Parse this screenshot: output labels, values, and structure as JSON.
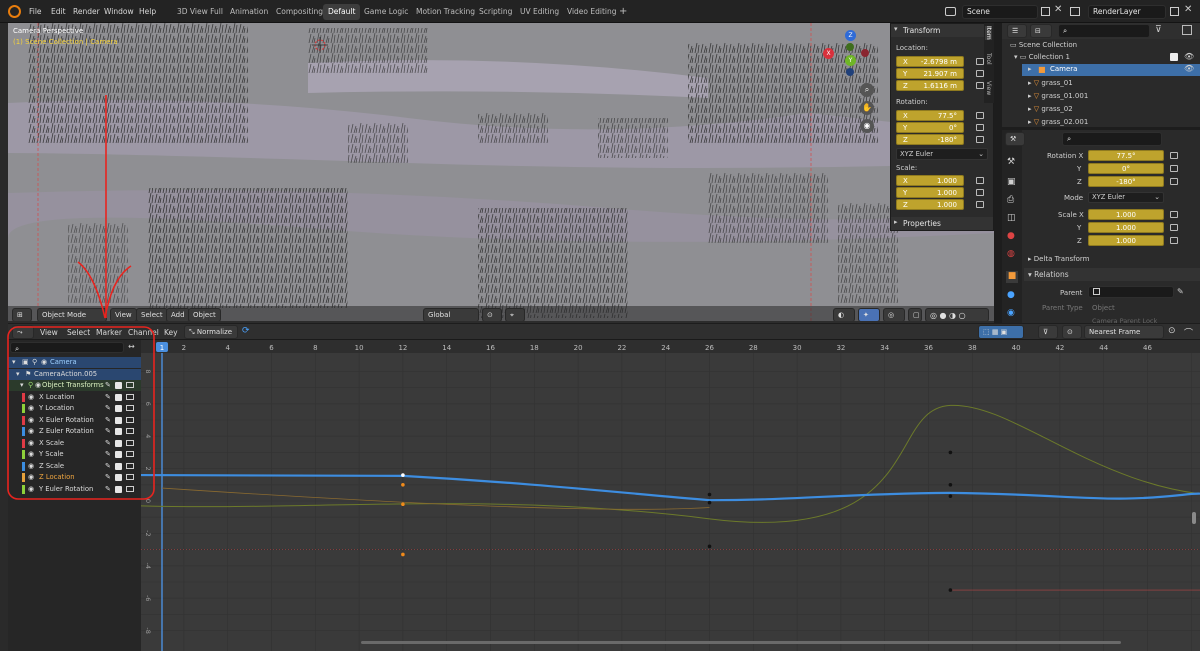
{
  "topbar": {
    "menus": [
      "File",
      "Edit",
      "Render",
      "Window",
      "Help"
    ],
    "workspaces": [
      "3D View Full",
      "Animation",
      "Compositing",
      "Default",
      "Game Logic",
      "Motion Tracking",
      "Scripting",
      "UV Editing",
      "Video Editing"
    ],
    "active_workspace": "Default",
    "add_tab": "+",
    "scene": "Scene",
    "render_layer": "RenderLayer"
  },
  "viewport": {
    "title": "Camera Perspective",
    "subtitle": "(1) Scene Collection | Camera",
    "mode": "Object Mode",
    "menus": [
      "View",
      "Select",
      "Add",
      "Object"
    ],
    "orientation": "Global",
    "gizmo": {
      "x": "X",
      "y": "Y",
      "z": "Z"
    }
  },
  "npanel": {
    "header": "Transform",
    "location_label": "Location:",
    "location": [
      {
        "axis": "X",
        "value": "-2.6798 m"
      },
      {
        "axis": "Y",
        "value": "21.907 m"
      },
      {
        "axis": "Z",
        "value": "1.6116 m"
      }
    ],
    "rotation_label": "Rotation:",
    "rotation": [
      {
        "axis": "X",
        "value": "77.5°"
      },
      {
        "axis": "Y",
        "value": "0°"
      },
      {
        "axis": "Z",
        "value": "-180°"
      }
    ],
    "rotation_mode": "XYZ Euler",
    "scale_label": "Scale:",
    "scale": [
      {
        "axis": "X",
        "value": "1.000"
      },
      {
        "axis": "Y",
        "value": "1.000"
      },
      {
        "axis": "Z",
        "value": "1.000"
      }
    ],
    "properties": "Properties",
    "tabs": [
      "Item",
      "Tool",
      "View"
    ]
  },
  "outliner": {
    "items": [
      {
        "name": "Scene Collection",
        "level": 0
      },
      {
        "name": "Collection 1",
        "level": 1
      },
      {
        "name": "Camera",
        "level": 2,
        "selected": true
      },
      {
        "name": "grass_01",
        "level": 2
      },
      {
        "name": "grass_01.001",
        "level": 2
      },
      {
        "name": "grass_02",
        "level": 2
      },
      {
        "name": "grass_02.001",
        "level": 2
      }
    ]
  },
  "properties": {
    "rotation": [
      {
        "label": "Rotation X",
        "value": "77.5°"
      },
      {
        "label": "Y",
        "value": "0°"
      },
      {
        "label": "Z",
        "value": "-180°"
      }
    ],
    "mode_label": "Mode",
    "mode_value": "XYZ Euler",
    "scale": [
      {
        "label": "Scale X",
        "value": "1.000"
      },
      {
        "label": "Y",
        "value": "1.000"
      },
      {
        "label": "Z",
        "value": "1.000"
      }
    ],
    "delta": "Delta Transform",
    "relations": "Relations",
    "parent_label": "Parent",
    "parent_type_label": "Parent Type",
    "parent_type_value": "Object",
    "camera_parent_lock": "Camera Parent Lock"
  },
  "graph_header": {
    "menus": [
      "View",
      "Select",
      "Marker",
      "Channel",
      "Key"
    ],
    "normalize": "Normalize",
    "interpolation": "Nearest Frame"
  },
  "channels": {
    "rows": [
      {
        "label": "Camera",
        "color": "#5fb0ff",
        "level": 0
      },
      {
        "label": "CameraAction.005",
        "color": "#d0d0d0",
        "level": 1
      },
      {
        "label": "Object Transforms",
        "color": "#9ad66f",
        "level": 2
      },
      {
        "label": "X Location",
        "color": "#e03a45",
        "level": 3
      },
      {
        "label": "Y Location",
        "color": "#8ed13a",
        "level": 3
      },
      {
        "label": "X Euler Rotation",
        "color": "#e03a45",
        "level": 3
      },
      {
        "label": "Z Euler Rotation",
        "color": "#3b8de0",
        "level": 3
      },
      {
        "label": "X Scale",
        "color": "#e03a45",
        "level": 3
      },
      {
        "label": "Y Scale",
        "color": "#8ed13a",
        "level": 3
      },
      {
        "label": "Z Scale",
        "color": "#3b8de0",
        "level": 3
      },
      {
        "label": "Z Location",
        "color": "#e6a23c",
        "level": 3
      },
      {
        "label": "Y Euler Rotation",
        "color": "#8ed13a",
        "level": 3
      }
    ]
  },
  "graph": {
    "current_frame": "1",
    "frames": [
      "2",
      "4",
      "6",
      "8",
      "10",
      "12",
      "14",
      "16",
      "18",
      "20",
      "22",
      "24",
      "26",
      "28",
      "30",
      "32",
      "34",
      "36",
      "38",
      "40",
      "42",
      "44",
      "46"
    ],
    "yticks": [
      "8",
      "6",
      "4",
      "2",
      "0",
      "-2",
      "-4",
      "-6",
      "-8"
    ]
  },
  "colors": {
    "annotation": "#e8241f",
    "keyframe_field": "#bea32d",
    "selection": "#3d6fa8"
  }
}
